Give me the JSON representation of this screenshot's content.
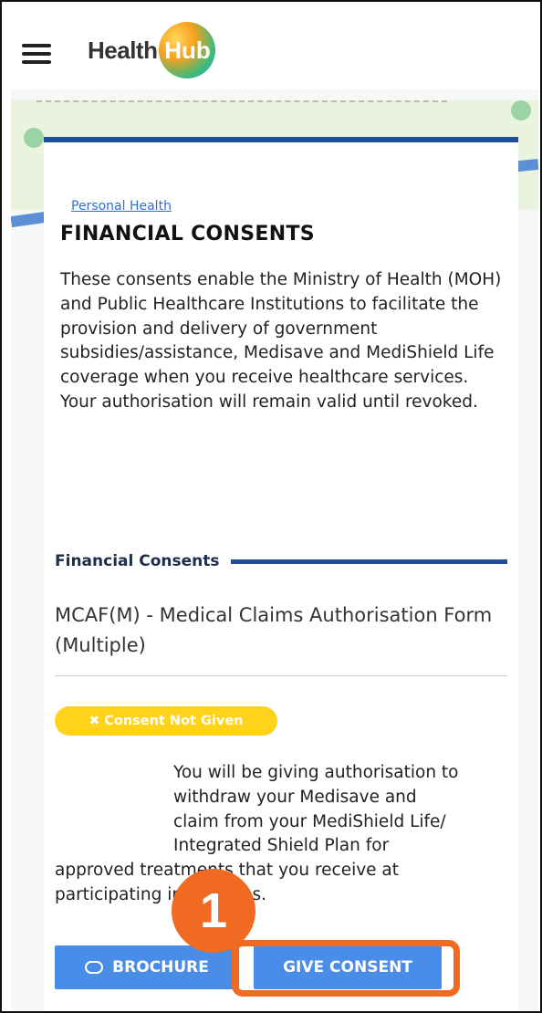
{
  "header": {
    "brand_text": "Health",
    "brand_badge": "Hub",
    "menu_icon": "hamburger-menu-icon"
  },
  "breadcrumb": {
    "label": "Personal Health"
  },
  "page": {
    "title": "FINANCIAL CONSENTS",
    "description": "These consents enable the Ministry of Health (MOH) and Public Healthcare Institutions to facilitate the provision and delivery of government subsidies/assistance, Medisave and MediShield Life coverage when you receive healthcare services. Your authorisation will remain valid until revoked."
  },
  "section": {
    "label": "Financial Consents"
  },
  "consent_item": {
    "name": "MCAF(M) - Medical Claims Authorisation Form (Multiple)",
    "status_icon": "close-icon",
    "status_label": "Consent Not Given",
    "status_color": "#ffd21c",
    "authorisation_text_line1": "You will be giving authorisation to",
    "authorisation_text_line2": "withdraw your Medisave and",
    "authorisation_text_line3": "claim from your MediShield Life/",
    "authorisation_text_line4": "Integrated Shield Plan for",
    "authorisation_text_line5": "approved treatments that you receive at",
    "authorisation_text_line6": "participating institutions."
  },
  "buttons": {
    "brochure_icon": "cloud-download-icon",
    "brochure_label": "BROCHURE",
    "give_consent_label": "GIVE CONSENT",
    "button_color": "#4a8de8"
  },
  "annotation": {
    "step_number": "1",
    "accent_color": "#f06a22"
  }
}
